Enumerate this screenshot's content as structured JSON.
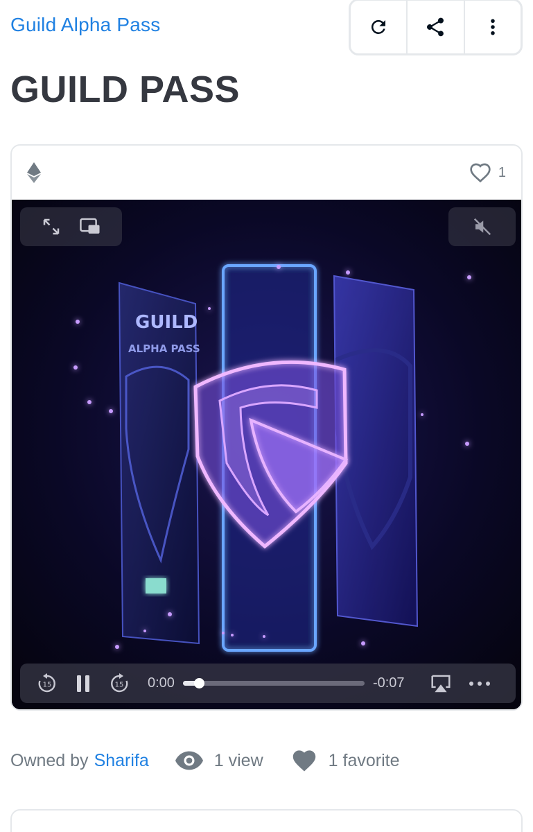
{
  "header": {
    "collection_name": "Guild Alpha Pass",
    "title": "GUILD PASS"
  },
  "toolbar": {
    "refresh_icon": "refresh-icon",
    "share_icon": "share-icon",
    "more_icon": "more-vertical-icon"
  },
  "card": {
    "chain_icon": "ethereum-icon",
    "favorite_count": "1"
  },
  "player": {
    "current_time": "0:00",
    "remaining_time": "-0:07",
    "progress": 0.06,
    "muted": true
  },
  "artwork": {
    "left_card_text_line1": "GUILD",
    "left_card_text_line2": "ALPHA PASS"
  },
  "meta": {
    "owned_by_label": "Owned by",
    "owner": "Sharifa",
    "views": "1 view",
    "favorites": "1 favorite"
  },
  "colors": {
    "accent": "#2081e2",
    "text": "#353840",
    "muted": "#707a83",
    "border": "#e5e8eb"
  }
}
